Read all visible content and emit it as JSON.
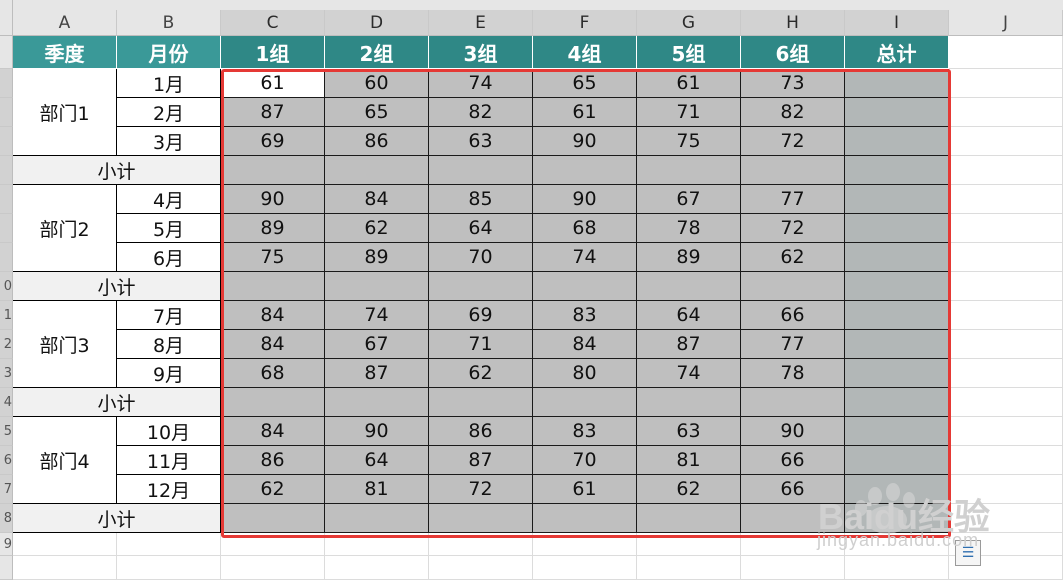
{
  "column_headers": [
    "A",
    "B",
    "C",
    "D",
    "E",
    "F",
    "G",
    "H",
    "I",
    "J"
  ],
  "row_numbers": [
    "",
    "",
    "",
    "",
    "",
    "",
    "",
    "",
    "",
    "0",
    "1",
    "2",
    "3",
    "4",
    "5",
    "6",
    "7",
    "8",
    "9"
  ],
  "header_row": [
    "季度",
    "月份",
    "1组",
    "2组",
    "3组",
    "4组",
    "5组",
    "6组",
    "总计"
  ],
  "departments": [
    {
      "name": "部门1",
      "months": [
        "1月",
        "2月",
        "3月"
      ],
      "values": [
        [
          61,
          60,
          74,
          65,
          61,
          73
        ],
        [
          87,
          65,
          82,
          61,
          71,
          82
        ],
        [
          69,
          86,
          63,
          90,
          75,
          72
        ]
      ],
      "subtotal_label": "小计"
    },
    {
      "name": "部门2",
      "months": [
        "4月",
        "5月",
        "6月"
      ],
      "values": [
        [
          90,
          84,
          85,
          90,
          67,
          77
        ],
        [
          89,
          62,
          64,
          68,
          78,
          72
        ],
        [
          75,
          89,
          70,
          74,
          89,
          62
        ]
      ],
      "subtotal_label": "小计"
    },
    {
      "name": "部门3",
      "months": [
        "7月",
        "8月",
        "9月"
      ],
      "values": [
        [
          84,
          74,
          69,
          83,
          64,
          66
        ],
        [
          84,
          67,
          71,
          84,
          87,
          77
        ],
        [
          68,
          87,
          62,
          80,
          74,
          78
        ]
      ],
      "subtotal_label": "小计"
    },
    {
      "name": "部门4",
      "months": [
        "10月",
        "11月",
        "12月"
      ],
      "values": [
        [
          84,
          90,
          86,
          83,
          63,
          90
        ],
        [
          86,
          64,
          87,
          70,
          81,
          66
        ],
        [
          62,
          81,
          72,
          61,
          62,
          66
        ]
      ],
      "subtotal_label": "小计"
    }
  ],
  "watermark": {
    "logo_text": "Baidu经验",
    "url_text": "jingyan.baidu.com"
  },
  "colors": {
    "header_teal": "#3a9998",
    "selection_border": "#e53935",
    "data_fill": "#bfbfbf",
    "total_fill": "#b2b7b7"
  }
}
